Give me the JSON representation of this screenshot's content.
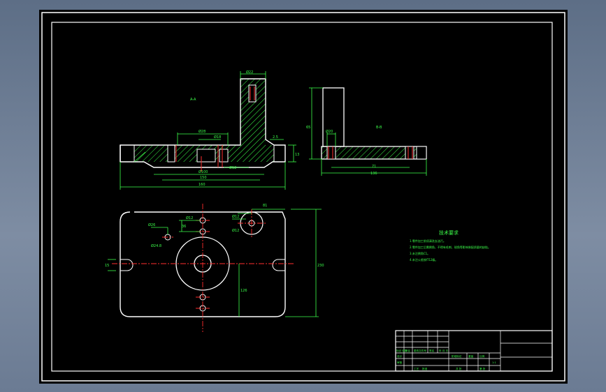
{
  "section_views": {
    "left_label": "A-A",
    "right_label": "B-B",
    "dims_left_view": [
      "Ø22",
      "Ø28",
      "Ø18",
      "2.5",
      "Ø100",
      "Ø12",
      "13",
      "150",
      "160"
    ],
    "dims_right_view": [
      "65",
      "Ø20",
      "71",
      "136"
    ]
  },
  "plan_view": {
    "dims": [
      "Ø26",
      "36",
      "Ø12",
      "Ø12",
      "81",
      "Ø12",
      "Ø24.8",
      "126",
      "15",
      "230"
    ]
  },
  "technical_requirements": {
    "title": "技术要求",
    "lines": [
      "1.零件加工前须清洗去油污。",
      "2.零件加工后需倒角，不得有毛刺、锐角等影响装配质量的缺陷。",
      "3.未注倒角C1。",
      "4.未注公差按IT12级。"
    ]
  },
  "title_block": {
    "row_labels": [
      "标记 处数",
      "分区",
      "更改文件号",
      "签名",
      "年 月 日"
    ],
    "labels": [
      "设计",
      "审核",
      "工艺",
      "批准",
      "阶段标记",
      "重量",
      "比例",
      "共 张",
      "第 张"
    ],
    "scale": "1:1"
  },
  "colors": {
    "paper": "#000000",
    "outline": "#ffffff",
    "dimension": "#3cff4a",
    "centerline": "#ff2e2e",
    "hatch": "#3cff4a"
  }
}
